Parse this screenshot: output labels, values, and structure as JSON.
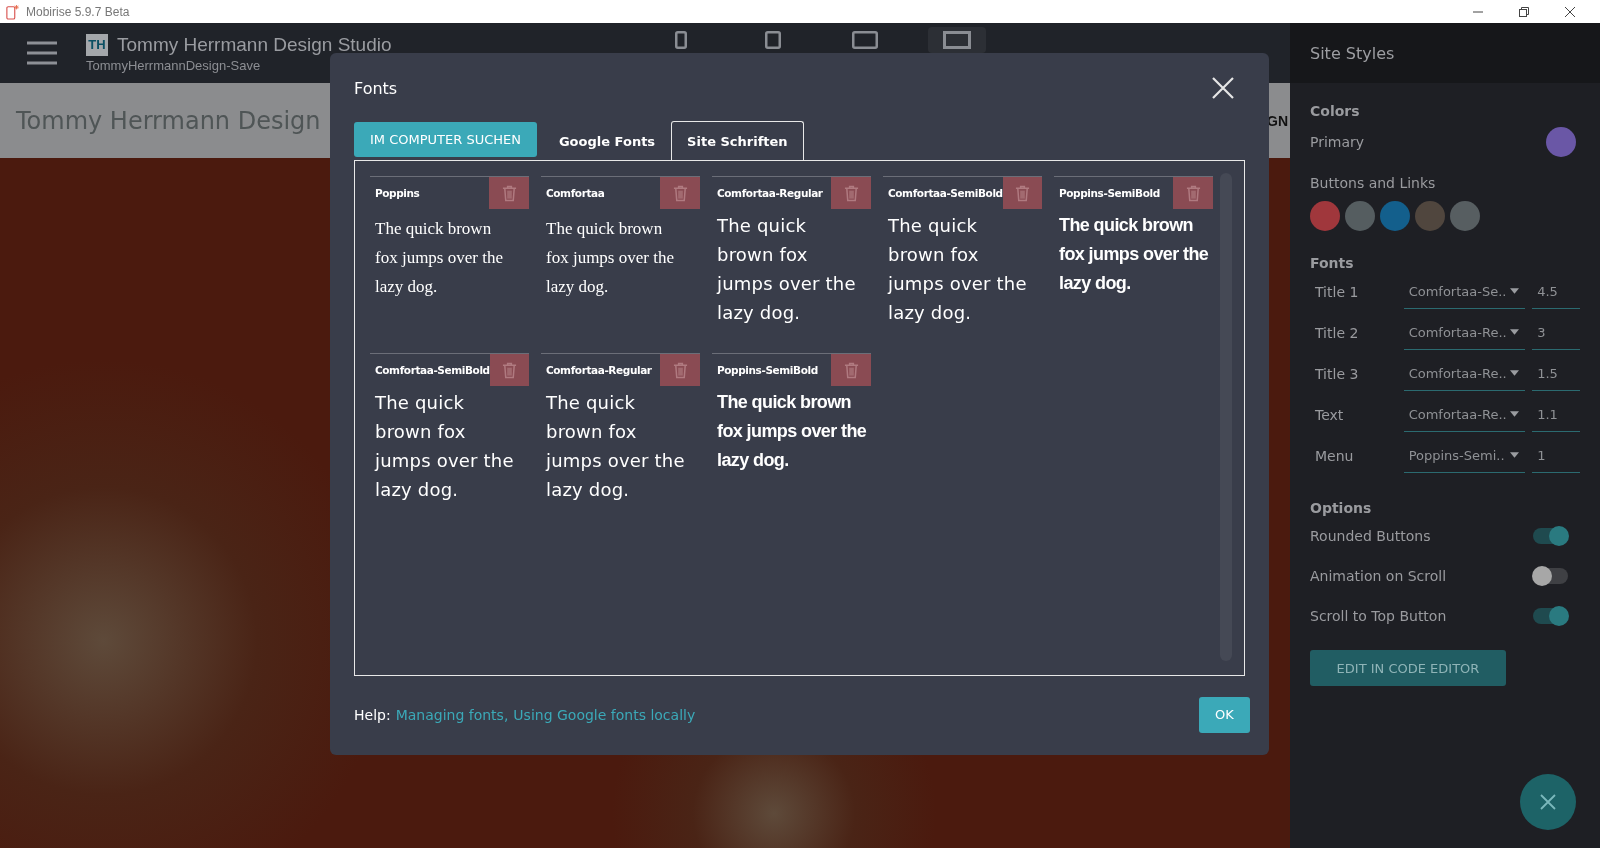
{
  "window": {
    "title": "Mobirise 5.9.7 Beta"
  },
  "header": {
    "logo_text": "TH",
    "site_name": "Tommy Herrmann Design Studio",
    "project": "TommyHerrmannDesign-Save",
    "devices": [
      {
        "kind": "phone",
        "selected": false
      },
      {
        "kind": "tablet",
        "selected": false
      },
      {
        "kind": "landscape",
        "selected": false
      },
      {
        "kind": "desktop",
        "selected": true
      }
    ]
  },
  "preview": {
    "heading": "Tommy Herrmann Design",
    "menu_fragment": "GN"
  },
  "dialog": {
    "title": "Fonts",
    "upload_button": "IM COMPUTER SUCHEN",
    "tabs": [
      {
        "label": "Google Fonts",
        "selected": false
      },
      {
        "label": "Site Schriften",
        "selected": true
      }
    ],
    "fonts": [
      {
        "name": "Poppins",
        "kind": "serif",
        "sample": "The quick brown fox jumps over the lazy dog."
      },
      {
        "name": "Comfortaa",
        "kind": "serif",
        "sample": "The quick brown fox jumps over the lazy dog."
      },
      {
        "name": "Comfortaa-Regular",
        "kind": "round",
        "sample": "The quick brown fox jumps over the lazy dog."
      },
      {
        "name": "Comfortaa-SemiBold",
        "kind": "round",
        "sample": "The quick brown fox jumps over the lazy dog."
      },
      {
        "name": "Poppins-SemiBold",
        "kind": "bold",
        "sample": "The quick brown fox jumps over the lazy dog."
      },
      {
        "name": "Comfortaa-SemiBold",
        "kind": "round",
        "sample": "The quick brown fox jumps over the lazy dog."
      },
      {
        "name": "Comfortaa-Regular",
        "kind": "round",
        "sample": "The quick brown fox jumps over the lazy dog."
      },
      {
        "name": "Poppins-SemiBold",
        "kind": "bold",
        "sample": "The quick brown fox jumps over the lazy dog."
      }
    ],
    "help_label": "Help:",
    "help_links": [
      "Managing fonts,",
      "Using Google fonts locally"
    ],
    "ok_button": "OK"
  },
  "sidebar": {
    "title": "Site Styles",
    "colors_heading": "Colors",
    "primary": {
      "label": "Primary",
      "color": "#6a57a6"
    },
    "buttons_label": "Buttons and Links",
    "button_colors": [
      {
        "color": "#a0373c"
      },
      {
        "color": "#555d60"
      },
      {
        "color": "#135f8c"
      },
      {
        "color": "#50463e"
      },
      {
        "color": "#575e61"
      }
    ],
    "fonts_heading": "Fonts",
    "font_rows": [
      {
        "label": "Title 1",
        "font": "Comfortaa-Se..",
        "size": "4.5"
      },
      {
        "label": "Title 2",
        "font": "Comfortaa-Re..",
        "size": "3"
      },
      {
        "label": "Title 3",
        "font": "Comfortaa-Re..",
        "size": "1.5"
      },
      {
        "label": "Text",
        "font": "Comfortaa-Re..",
        "size": "1.1"
      },
      {
        "label": "Menu",
        "font": "Poppins-Semi..",
        "size": "1"
      }
    ],
    "options_heading": "Options",
    "options": [
      {
        "label": "Rounded Buttons",
        "on": true
      },
      {
        "label": "Animation on Scroll",
        "on": false
      },
      {
        "label": "Scroll to Top Button",
        "on": true
      }
    ],
    "edit_button": "EDIT IN CODE EDITOR"
  }
}
